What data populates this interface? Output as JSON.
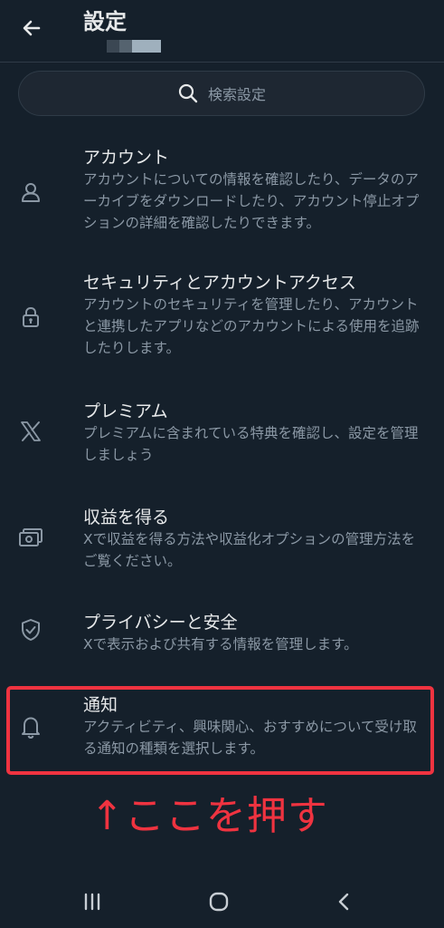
{
  "header": {
    "title": "設定",
    "back_icon": "arrow-left-icon"
  },
  "search": {
    "placeholder": "検索設定",
    "icon": "search-icon"
  },
  "menu": {
    "items": [
      {
        "icon": "person-icon",
        "title": "アカウント",
        "desc": "アカウントについての情報を確認したり、データのアーカイブをダウンロードしたり、アカウント停止オプションの詳細を確認したりできます。"
      },
      {
        "icon": "lock-icon",
        "title": "セキュリティとアカウントアクセス",
        "desc": "アカウントのセキュリティを管理したり、アカウントと連携したアプリなどのアカウントによる使用を追跡したりします。"
      },
      {
        "icon": "x-logo-icon",
        "title": "プレミアム",
        "desc": "プレミアムに含まれている特典を確認し、設定を管理しましょう"
      },
      {
        "icon": "money-icon",
        "title": "収益を得る",
        "desc": "Xで収益を得る方法や収益化オプションの管理方法をご覧ください。"
      },
      {
        "icon": "shield-check-icon",
        "title": "プライバシーと安全",
        "desc": "Xで表示および共有する情報を管理します。"
      },
      {
        "icon": "bell-icon",
        "title": "通知",
        "desc": "アクティビティ、興味関心、おすすめについて受け取る通知の種類を選択します。"
      }
    ]
  },
  "annotation": {
    "text": "↑ここを押す"
  },
  "nav": {
    "recents_icon": "recents-icon",
    "home_icon": "home-icon",
    "back_icon": "chevron-left-icon"
  },
  "colors": {
    "background": "#15202b",
    "text_primary": "#e7e9ea",
    "text_secondary": "#8b98a5",
    "highlight": "#ef3340"
  }
}
